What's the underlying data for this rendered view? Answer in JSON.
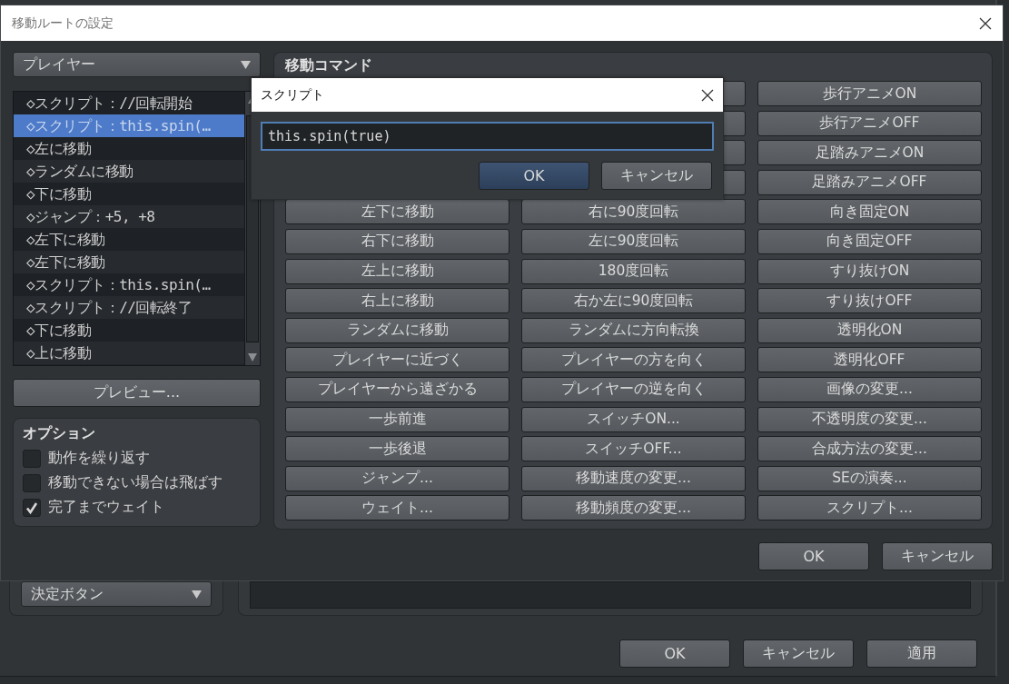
{
  "background_window": {
    "trigger_select": {
      "value": "決定ボタン"
    },
    "buttons": [
      "OK",
      "キャンセル",
      "適用"
    ]
  },
  "move_route_dialog": {
    "title": "移動ルートの設定",
    "target_select": {
      "value": "プレイヤー"
    },
    "route_list": [
      {
        "text": "◇スクリプト：//回転開始",
        "selected": false
      },
      {
        "text": "◇スクリプト：this.spin(…",
        "selected": true
      },
      {
        "text": "◇左に移動",
        "selected": false
      },
      {
        "text": "◇ランダムに移動",
        "selected": false
      },
      {
        "text": "◇下に移動",
        "selected": false
      },
      {
        "text": "◇ジャンプ：+5, +8",
        "selected": false
      },
      {
        "text": "◇左下に移動",
        "selected": false
      },
      {
        "text": "◇左下に移動",
        "selected": false
      },
      {
        "text": "◇スクリプト：this.spin(…",
        "selected": false
      },
      {
        "text": "◇スクリプト：//回転終了",
        "selected": false
      },
      {
        "text": "◇下に移動",
        "selected": false
      },
      {
        "text": "◇上に移動",
        "selected": false
      }
    ],
    "preview_button": "プレビュー...",
    "options": {
      "title": "オプション",
      "items": [
        {
          "label": "動作を繰り返す",
          "checked": false
        },
        {
          "label": "移動できない場合は飛ばす",
          "checked": false
        },
        {
          "label": "完了までウェイト",
          "checked": true
        }
      ]
    },
    "commands": {
      "title": "移動コマンド",
      "columns": [
        [
          {
            "kind": "button",
            "label": "左下に移動"
          },
          {
            "kind": "button",
            "label": "右下に移動"
          },
          {
            "kind": "button",
            "label": "左上に移動"
          },
          {
            "kind": "button",
            "label": "右上に移動"
          },
          {
            "kind": "button",
            "label": "ランダムに移動"
          },
          {
            "kind": "button",
            "label": "プレイヤーに近づく"
          },
          {
            "kind": "button",
            "label": "プレイヤーから遠ざかる"
          },
          {
            "kind": "button",
            "label": "一歩前進"
          },
          {
            "kind": "button",
            "label": "一歩後退"
          },
          {
            "kind": "button",
            "label": "ジャンプ..."
          },
          {
            "kind": "button",
            "label": "ウェイト..."
          }
        ],
        [
          {
            "kind": "covered"
          },
          {
            "kind": "covered"
          },
          {
            "kind": "covered"
          },
          {
            "kind": "covered"
          },
          {
            "kind": "button",
            "label": "右に90度回転"
          },
          {
            "kind": "button",
            "label": "左に90度回転"
          },
          {
            "kind": "button",
            "label": "180度回転"
          },
          {
            "kind": "button",
            "label": "右か左に90度回転"
          },
          {
            "kind": "button",
            "label": "ランダムに方向転換"
          },
          {
            "kind": "button",
            "label": "プレイヤーの方を向く"
          },
          {
            "kind": "button",
            "label": "プレイヤーの逆を向く"
          },
          {
            "kind": "button",
            "label": "スイッチON..."
          },
          {
            "kind": "button",
            "label": "スイッチOFF..."
          },
          {
            "kind": "button",
            "label": "移動速度の変更..."
          },
          {
            "kind": "button",
            "label": "移動頻度の変更..."
          }
        ],
        [
          {
            "kind": "button",
            "label": "歩行アニメON"
          },
          {
            "kind": "button",
            "label": "歩行アニメOFF"
          },
          {
            "kind": "button",
            "label": "足踏みアニメON"
          },
          {
            "kind": "button",
            "label": "足踏みアニメOFF"
          },
          {
            "kind": "button",
            "label": "向き固定ON"
          },
          {
            "kind": "button",
            "label": "向き固定OFF"
          },
          {
            "kind": "button",
            "label": "すり抜けON"
          },
          {
            "kind": "button",
            "label": "すり抜けOFF"
          },
          {
            "kind": "button",
            "label": "透明化ON"
          },
          {
            "kind": "button",
            "label": "透明化OFF"
          },
          {
            "kind": "button",
            "label": "画像の変更..."
          },
          {
            "kind": "button",
            "label": "不透明度の変更..."
          },
          {
            "kind": "button",
            "label": "合成方法の変更..."
          },
          {
            "kind": "button",
            "label": "SEの演奏..."
          },
          {
            "kind": "button",
            "label": "スクリプト..."
          }
        ]
      ]
    },
    "buttons": [
      "OK",
      "キャンセル"
    ]
  },
  "script_dialog": {
    "title": "スクリプト",
    "input": {
      "value": "this.spin(true)"
    },
    "buttons": [
      {
        "label": "OK",
        "selected": true
      },
      {
        "label": "キャンセル",
        "selected": false
      }
    ]
  }
}
